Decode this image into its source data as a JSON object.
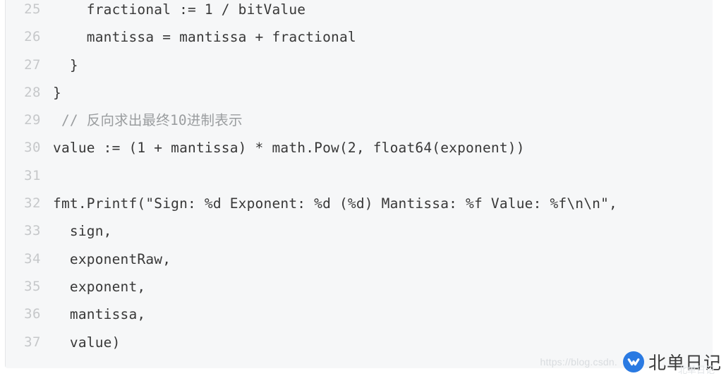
{
  "editor": {
    "language": "go",
    "background_color": "#f6f7f8",
    "text_color": "#383838",
    "comment_color": "#9a9d9f",
    "line_number_color": "#c6c8ca",
    "lines": [
      {
        "number": "25",
        "text": "    fractional := 1 / bitValue",
        "kind": "code"
      },
      {
        "number": "26",
        "text": "    mantissa = mantissa + fractional",
        "kind": "code"
      },
      {
        "number": "27",
        "text": "  }",
        "kind": "code"
      },
      {
        "number": "28",
        "text": "}",
        "kind": "code"
      },
      {
        "number": "29",
        "text": " // 反向求出最终10进制表示",
        "kind": "comment"
      },
      {
        "number": "30",
        "text": "value := (1 + mantissa) * math.Pow(2, float64(exponent))",
        "kind": "code"
      },
      {
        "number": "31",
        "text": "",
        "kind": "code"
      },
      {
        "number": "32",
        "text": "fmt.Printf(\"Sign: %d Exponent: %d (%d) Mantissa: %f Value: %f\\n\\n\",",
        "kind": "code"
      },
      {
        "number": "33",
        "text": "  sign,",
        "kind": "code"
      },
      {
        "number": "34",
        "text": "  exponentRaw,",
        "kind": "code"
      },
      {
        "number": "35",
        "text": "  exponent,",
        "kind": "code"
      },
      {
        "number": "36",
        "text": "  mantissa,",
        "kind": "code"
      },
      {
        "number": "37",
        "text": "  value)",
        "kind": "code"
      }
    ]
  },
  "watermark": {
    "url": "https://blog.csdn.",
    "logo_icon": "csdn-blue-circle-logo",
    "logo_color": "#2a7ae2",
    "name": "北单日记",
    "ghost_text": "北单日记"
  }
}
